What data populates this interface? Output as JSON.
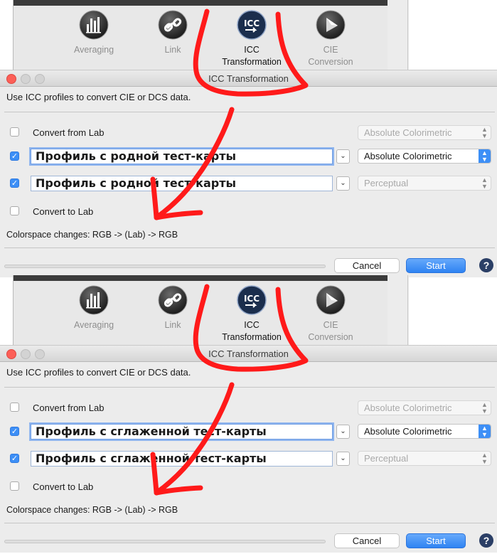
{
  "colors": {
    "accent": "#3d8ff6",
    "annotation": "#ff0000",
    "close": "#fc5f57",
    "help": "#2b3f66"
  },
  "toolbar": {
    "items": [
      {
        "label": "Averaging",
        "icon": "histogram-icon"
      },
      {
        "label": "Link",
        "icon": "chain-link-icon"
      },
      {
        "label": "ICC\nTransformation",
        "icon": "icc-icon"
      },
      {
        "label": "CIE\nConversion",
        "icon": "prism-icon"
      }
    ]
  },
  "screens": [
    {
      "window_title": "ICC Transformation",
      "description": "Use ICC profiles to convert CIE or DCS data.",
      "convert_from_lab": {
        "label": "Convert from Lab",
        "checked": false,
        "intent": "Absolute Colorimetric"
      },
      "source_profile": {
        "value": "Профиль с родной тест-карты",
        "checked": true,
        "intent": "Absolute Colorimetric"
      },
      "dest_profile": {
        "value": "Профиль с родной тест-карты",
        "checked": true,
        "intent": "Perceptual"
      },
      "convert_to_lab": {
        "label": "Convert to Lab",
        "checked": false
      },
      "colorspace": "Colorspace changes: RGB -> (Lab) -> RGB",
      "cancel_label": "Cancel",
      "start_label": "Start",
      "help_label": "?"
    },
    {
      "window_title": "ICC Transformation",
      "description": "Use ICC profiles to convert CIE or DCS data.",
      "convert_from_lab": {
        "label": "Convert from Lab",
        "checked": false,
        "intent": "Absolute Colorimetric"
      },
      "source_profile": {
        "value": "Профиль с сглаженной тест-карты",
        "checked": true,
        "intent": "Absolute Colorimetric"
      },
      "dest_profile": {
        "value": "Профиль с сглаженной тест-карты",
        "checked": true,
        "intent": "Perceptual"
      },
      "convert_to_lab": {
        "label": "Convert to Lab",
        "checked": false
      },
      "colorspace": "Colorspace changes: RGB -> (Lab) -> RGB",
      "cancel_label": "Cancel",
      "start_label": "Start",
      "help_label": "?"
    }
  ]
}
